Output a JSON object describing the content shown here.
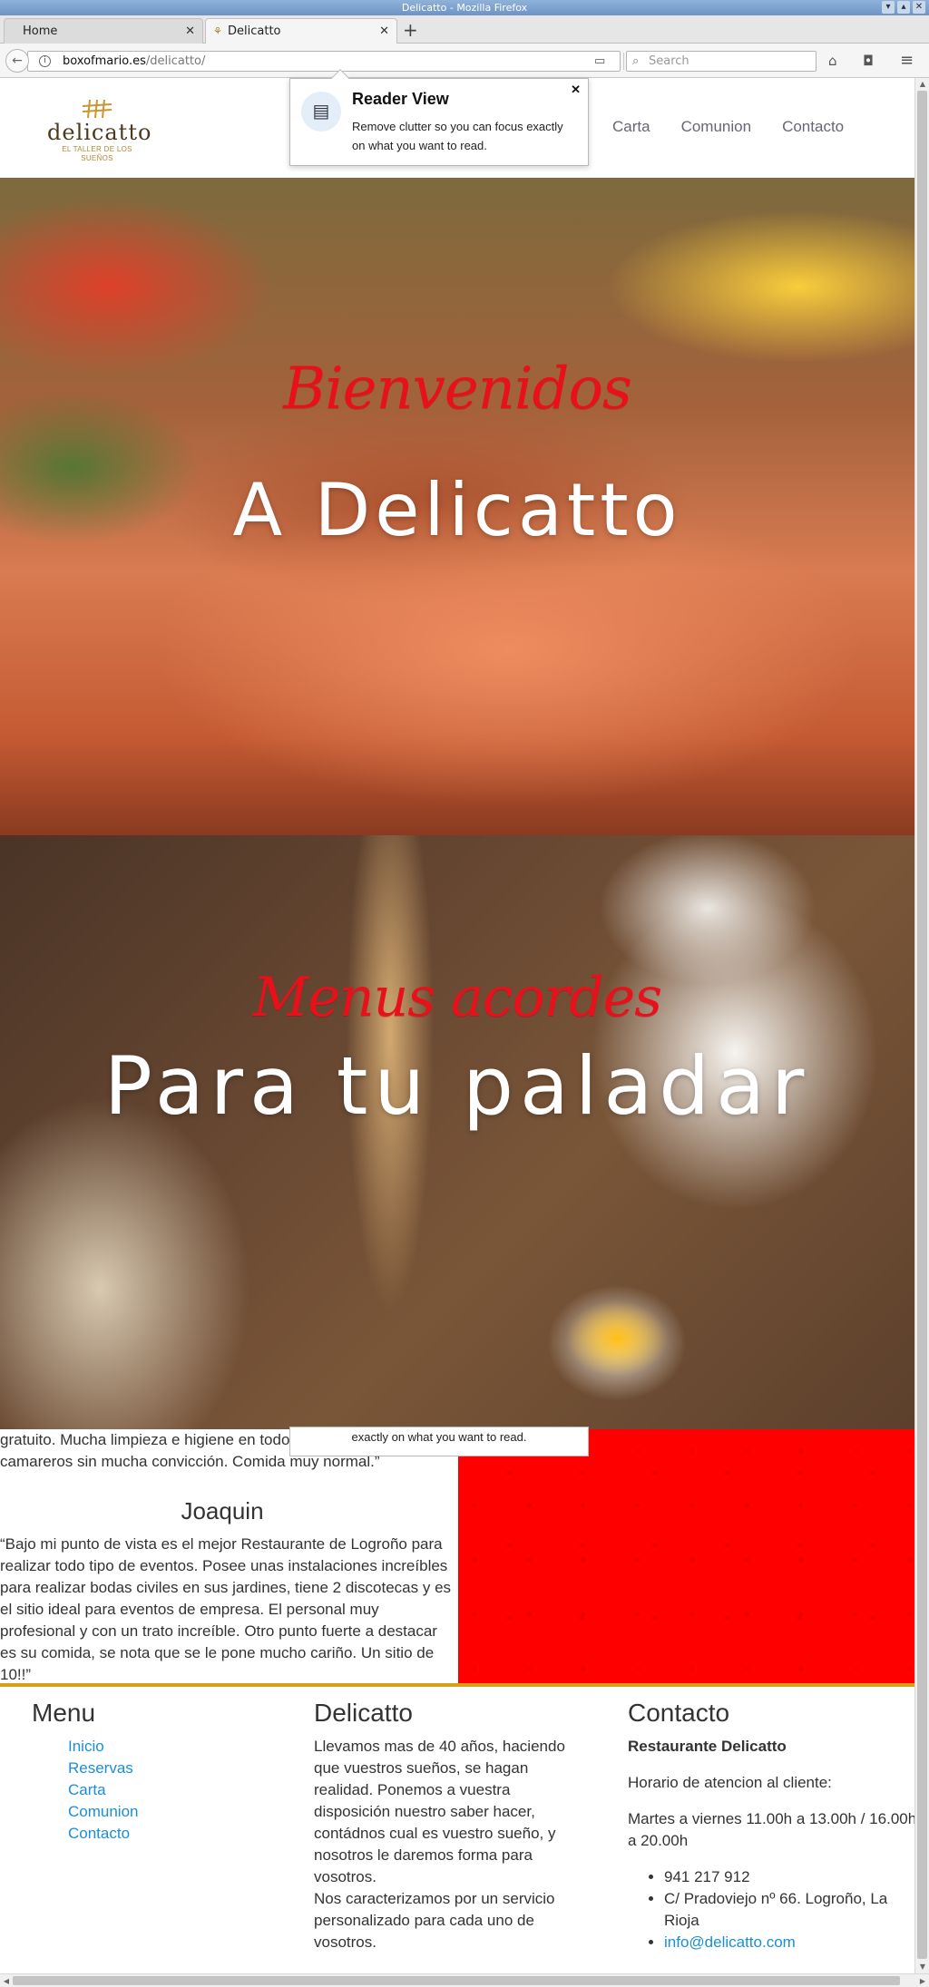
{
  "window": {
    "title": "Delicatto - Mozilla Firefox",
    "controls": [
      "▾",
      "▴",
      "✕"
    ]
  },
  "tabs": [
    {
      "label": "Home",
      "close": "✕"
    },
    {
      "label": "Delicatto",
      "close": "✕"
    }
  ],
  "newtab_label": "+",
  "nav": {
    "back": "←",
    "info": "i",
    "url_host": "boxofmario.es",
    "url_path": "/delicatto/",
    "reader_icon": "▭",
    "reload": "↻",
    "search_placeholder": "Search",
    "search_glyph": "⌕",
    "home": "⌂",
    "pocket": "◘",
    "menu": "≡"
  },
  "reader_view": {
    "title": "Reader View",
    "description": "Remove clutter so you can focus exactly on what you want to read.",
    "close": "✕",
    "icon": "▤",
    "ghost_text": "exactly on what you want to read."
  },
  "site": {
    "logo_name": "delicatto",
    "logo_tagline": "EL TALLER DE LOS SUEÑOS",
    "menu": [
      "Carta",
      "Comunion",
      "Contacto"
    ]
  },
  "hero1": {
    "script": "Bienvenidos",
    "big": "A Delicatto"
  },
  "hero2": {
    "script": "Menus acordes",
    "big": "Para tu paladar"
  },
  "testimonials": {
    "text1": "gratuito. Mucha limpieza e higiene en todo. Los servidos y camareros sin mucha convicción. Comida muy normal.”",
    "author": "Joaquin",
    "text2": "“Bajo mi punto de vista es el mejor Restaurante de Logroño para realizar todo tipo de eventos. Posee unas instalaciones increíbles para realizar bodas civiles en sus jardines, tiene 2 discotecas y es el sitio ideal para eventos de empresa. El personal muy profesional y con un trato increíble. Otro punto fuerte a destacar es su comida, se nota que se le pone mucho cariño. Un sitio de 10!!”"
  },
  "footer": {
    "menu_title": "Menu",
    "menu_items": [
      "Inicio",
      "Reservas",
      "Carta",
      "Comunion",
      "Contacto"
    ],
    "about_title": "Delicatto",
    "about_p1": "Llevamos mas de 40 años, haciendo que vuestros sueños, se hagan realidad. Ponemos a vuestra disposición nuestro saber hacer, contádnos cual es vuestro sueño, y nosotros le daremos forma para vosotros.",
    "about_p2": "Nos caracterizamos por un servicio personalizado para cada uno de vosotros.",
    "contact_title": "Contacto",
    "contact_name": "Restaurante Delicatto",
    "contact_hours_label": "Horario de atencion al cliente:",
    "contact_hours": "Martes a viernes 11.00h a 13.00h / 16.00h a 20.00h",
    "contact_phone": "941 217 912",
    "contact_address": "C/ Pradoviejo nº 66. Logroño, La Rioja",
    "contact_email": "info@delicatto.com"
  },
  "colors": {
    "accent_red": "#ff0000",
    "script_red": "#e8101b",
    "gold": "#d4a116",
    "link_blue": "#1a8fd6"
  }
}
